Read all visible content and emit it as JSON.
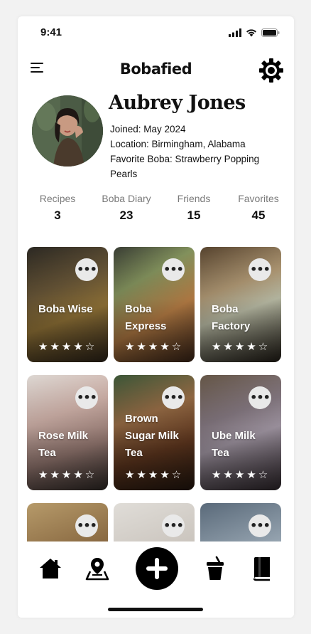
{
  "status_bar": {
    "time": "9:41"
  },
  "header": {
    "title": "Bobafied"
  },
  "profile": {
    "name": "Aubrey Jones",
    "joined": "Joined: May 2024",
    "location": "Location: Birmingham, Alabama",
    "favorite": "Favorite Boba: Strawberry Popping Pearls"
  },
  "stats": [
    {
      "label": "Recipes",
      "value": "3"
    },
    {
      "label": "Boba Diary",
      "value": "23"
    },
    {
      "label": "Friends",
      "value": "15"
    },
    {
      "label": "Favorites",
      "value": "45"
    }
  ],
  "cards": [
    {
      "title": "Boba Wise",
      "stars": "★★★★☆",
      "rating": 4,
      "more": "•••"
    },
    {
      "title": "Boba Express",
      "stars": "★★★★☆",
      "rating": 4,
      "more": "•••"
    },
    {
      "title": "Boba Factory",
      "stars": "★★★★☆",
      "rating": 4,
      "more": "•••"
    },
    {
      "title": "Rose Milk Tea",
      "stars": "★★★★☆",
      "rating": 4,
      "more": "•••"
    },
    {
      "title": "Brown Sugar Milk Tea",
      "stars": "★★★★☆",
      "rating": 4,
      "more": "•••"
    },
    {
      "title": "Ube Milk Tea",
      "stars": "★★★★☆",
      "rating": 4,
      "more": "•••"
    },
    {
      "title": "",
      "stars": "",
      "more": "•••"
    },
    {
      "title": "",
      "stars": "",
      "more": "•••"
    },
    {
      "title": "",
      "stars": "",
      "more": "•••"
    }
  ],
  "bottom_nav": {
    "items": [
      "home-icon",
      "map-pin-icon",
      "add-icon",
      "boba-cup-icon",
      "diary-book-icon"
    ]
  },
  "colors": {
    "accent": "#000000",
    "background": "#ffffff",
    "muted_text": "#7a7a7a",
    "chip": "#e9e9e9"
  }
}
